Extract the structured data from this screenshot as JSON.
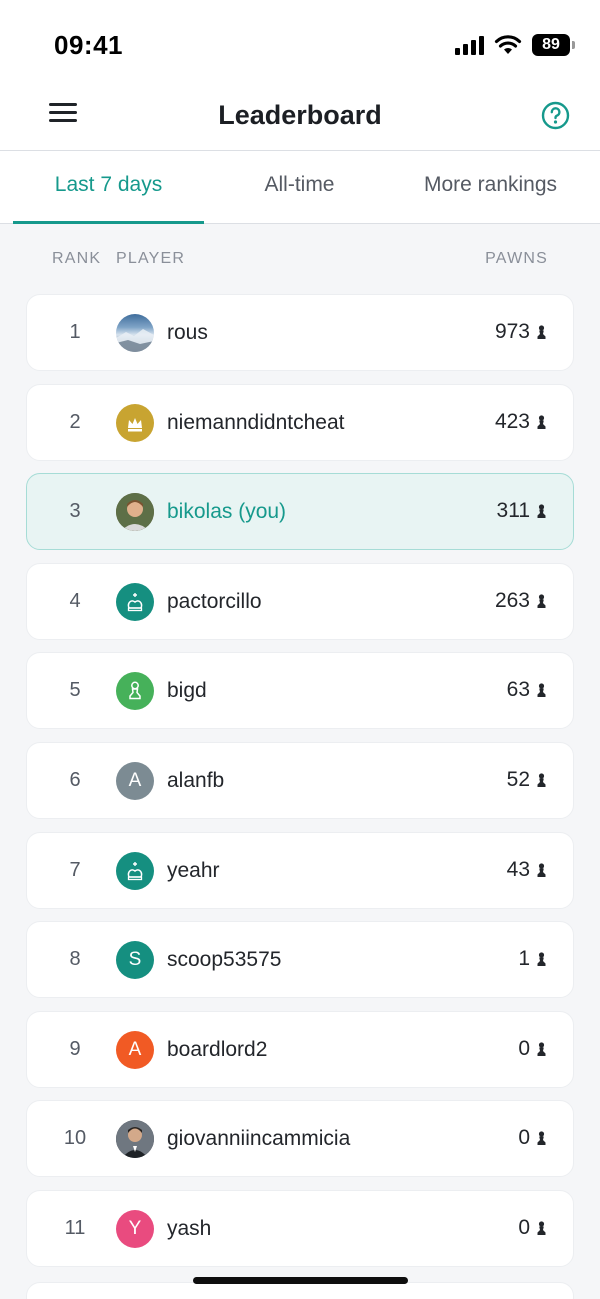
{
  "status": {
    "time": "09:41",
    "battery": "89"
  },
  "header": {
    "title": "Leaderboard",
    "menu_icon": "menu-icon",
    "help_icon": "help-icon"
  },
  "tabs": [
    {
      "label": "Last 7 days",
      "active": true
    },
    {
      "label": "All-time",
      "active": false
    },
    {
      "label": "More rankings",
      "active": false
    }
  ],
  "list_header": {
    "rank": "RANK",
    "player": "PLAYER",
    "pawns": "PAWNS"
  },
  "colors": {
    "accent": "#16998c",
    "highlight_bg": "#e8f4f3"
  },
  "players": [
    {
      "rank": "1",
      "name": "rous",
      "pawns": "973",
      "avatar": {
        "type": "photo-landscape-icon"
      }
    },
    {
      "rank": "2",
      "name": "niemanndidntcheat",
      "pawns": "423",
      "avatar": {
        "type": "king-icon",
        "color": "#c8a431"
      }
    },
    {
      "rank": "3",
      "name": "bikolas (you)",
      "pawns": "311",
      "avatar": {
        "type": "photo-person-icon"
      },
      "is_you": true
    },
    {
      "rank": "4",
      "name": "pactorcillo",
      "pawns": "263",
      "avatar": {
        "type": "king-icon",
        "color": "#158f80"
      }
    },
    {
      "rank": "5",
      "name": "bigd",
      "pawns": "63",
      "avatar": {
        "type": "pawn-icon",
        "color": "#46b15a"
      }
    },
    {
      "rank": "6",
      "name": "alanfb",
      "pawns": "52",
      "avatar": {
        "type": "letter",
        "letter": "A",
        "color": "#7c8b93"
      }
    },
    {
      "rank": "7",
      "name": "yeahr",
      "pawns": "43",
      "avatar": {
        "type": "king-icon",
        "color": "#158f80"
      }
    },
    {
      "rank": "8",
      "name": "scoop53575",
      "pawns": "1",
      "avatar": {
        "type": "letter",
        "letter": "S",
        "color": "#158f80"
      }
    },
    {
      "rank": "9",
      "name": "boardlord2",
      "pawns": "0",
      "avatar": {
        "type": "letter",
        "letter": "A",
        "color": "#f15a24"
      }
    },
    {
      "rank": "10",
      "name": "giovanniincammicia",
      "pawns": "0",
      "avatar": {
        "type": "photo-person-dark-icon"
      }
    },
    {
      "rank": "11",
      "name": "yash",
      "pawns": "0",
      "avatar": {
        "type": "letter",
        "letter": "Y",
        "color": "#e94b7f"
      }
    }
  ]
}
